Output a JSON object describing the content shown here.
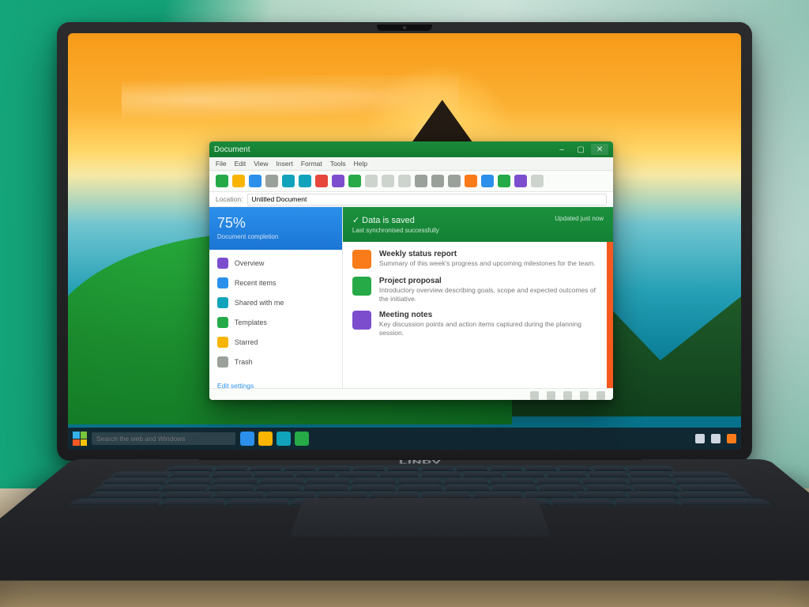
{
  "laptop": {
    "brand": "LINDV"
  },
  "taskbar": {
    "search_placeholder": "Search the web and Windows",
    "apps": [
      {
        "name": "browser",
        "color": "#2f8fe6"
      },
      {
        "name": "files",
        "color": "#f4b400"
      },
      {
        "name": "store",
        "color": "#17a2b8"
      },
      {
        "name": "mail",
        "color": "#2aa84a"
      }
    ],
    "tray": [
      {
        "name": "network",
        "color": "#cfd6df"
      },
      {
        "name": "volume",
        "color": "#cfd6df"
      },
      {
        "name": "action-center",
        "color": "#f57c1f"
      }
    ]
  },
  "window": {
    "title": "Document",
    "menu": [
      "File",
      "Edit",
      "View",
      "Insert",
      "Format",
      "Tools",
      "Help"
    ],
    "toolbar_icons": [
      {
        "name": "new",
        "color": "#2aa84a"
      },
      {
        "name": "open",
        "color": "#f4b400"
      },
      {
        "name": "save",
        "color": "#2f8fe6"
      },
      {
        "name": "print",
        "color": "#9aa09a"
      },
      {
        "name": "undo",
        "color": "#17a2b8"
      },
      {
        "name": "redo",
        "color": "#17a2b8"
      },
      {
        "name": "cut",
        "color": "#e04a3f"
      },
      {
        "name": "copy",
        "color": "#7b4fc9"
      },
      {
        "name": "paste",
        "color": "#2aa84a"
      },
      {
        "name": "bold",
        "color": "#cdd3cd"
      },
      {
        "name": "italic",
        "color": "#cdd3cd"
      },
      {
        "name": "underline",
        "color": "#cdd3cd"
      },
      {
        "name": "align-left",
        "color": "#9aa09a"
      },
      {
        "name": "align-center",
        "color": "#9aa09a"
      },
      {
        "name": "align-right",
        "color": "#9aa09a"
      },
      {
        "name": "list",
        "color": "#f57c1f"
      },
      {
        "name": "link",
        "color": "#2f8fe6"
      },
      {
        "name": "image",
        "color": "#2aa84a"
      },
      {
        "name": "table",
        "color": "#7b4fc9"
      },
      {
        "name": "zoom",
        "color": "#cdd3cd"
      }
    ],
    "address": {
      "label": "Location:",
      "value": "Untitled Document"
    },
    "sidebar": {
      "hero_value": "75%",
      "hero_caption": "Document completion",
      "items": [
        {
          "icon": "#7b4fc9",
          "label": "Overview"
        },
        {
          "icon": "#2f8fe6",
          "label": "Recent items"
        },
        {
          "icon": "#17a2b8",
          "label": "Shared with me"
        },
        {
          "icon": "#2aa84a",
          "label": "Templates"
        },
        {
          "icon": "#f4b400",
          "label": "Starred"
        },
        {
          "icon": "#9aa09a",
          "label": "Trash"
        }
      ],
      "footer": "Edit settings"
    },
    "hero": {
      "lead": "✓ Data is saved",
      "sub": "Last synchronised successfully",
      "meta": "Updated just now"
    },
    "feed": [
      {
        "thumb": "#f57c1f",
        "title": "Weekly status report",
        "body": "Summary of this week's progress and upcoming milestones for the team."
      },
      {
        "thumb": "#2aa84a",
        "title": "Project proposal",
        "body": "Introductory overview describing goals, scope and expected outcomes of the initiative."
      },
      {
        "thumb": "#7b4fc9",
        "title": "Meeting notes",
        "body": "Key discussion points and action items captured during the planning session."
      }
    ],
    "status_icons": [
      "spellcheck",
      "language",
      "zoom-out",
      "zoom-in",
      "page"
    ]
  }
}
